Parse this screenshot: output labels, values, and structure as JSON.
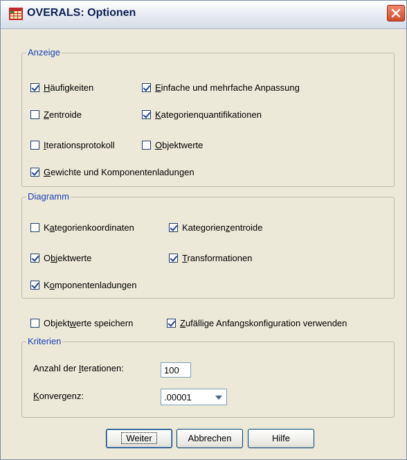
{
  "window": {
    "title": "OVERALS: Optionen",
    "app_icon": "spreadsheet-icon",
    "close_icon": "close-icon"
  },
  "display": {
    "legend": "Anzeige",
    "items": [
      {
        "pre": "",
        "mn": "H",
        "post": "äufigkeiten",
        "checked": true
      },
      {
        "pre": "",
        "mn": "Z",
        "post": "entroide",
        "checked": false
      },
      {
        "pre": "",
        "mn": "I",
        "post": "terationsprotokoll",
        "checked": false
      },
      {
        "pre": "",
        "mn": "G",
        "post": "ewichte und Komponentenladungen",
        "checked": true
      },
      {
        "pre": "",
        "mn": "E",
        "post": "infache und mehrfache Anpassung",
        "checked": true
      },
      {
        "pre": "",
        "mn": "K",
        "post": "ategorienquantifikationen",
        "checked": true
      },
      {
        "pre": "",
        "mn": "O",
        "post": "bjektwerte",
        "checked": false
      }
    ]
  },
  "plot": {
    "legend": "Diagramm",
    "items": [
      {
        "pre": "K",
        "mn": "a",
        "post": "tegorienkoordinaten",
        "checked": false
      },
      {
        "pre": "O",
        "mn": "b",
        "post": "jektwerte",
        "checked": true
      },
      {
        "pre": "K",
        "mn": "o",
        "post": "mponentenladungen",
        "checked": true
      },
      {
        "pre": "Kategorien",
        "mn": "z",
        "post": "entroide",
        "checked": true
      },
      {
        "pre": "",
        "mn": "T",
        "post": "ransformationen",
        "checked": true
      }
    ]
  },
  "save": {
    "pre": "Objekt",
    "mn": "w",
    "post": "erte speichern",
    "checked": false
  },
  "random": {
    "pre": "",
    "mn": "Z",
    "post": "ufällige Anfangskonfiguration verwenden",
    "checked": true
  },
  "criteria": {
    "legend": "Kriterien",
    "iterations_pre": "Anzahl der ",
    "iterations_mn": "I",
    "iterations_post": "terationen:",
    "iterations_value": "100",
    "convergence_pre": "",
    "convergence_mn": "K",
    "convergence_post": "onvergenz:",
    "convergence_value": ".00001",
    "dropdown_icon": "chevron-down-icon"
  },
  "buttons": {
    "continue": "Weiter",
    "cancel": "Abbrechen",
    "help": "Hilfe"
  }
}
